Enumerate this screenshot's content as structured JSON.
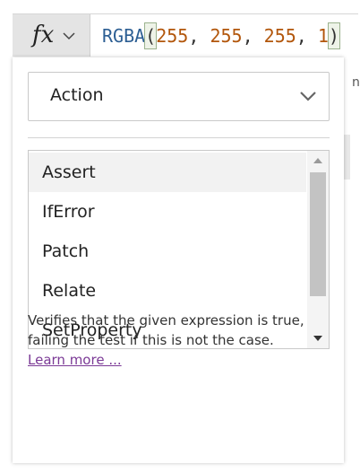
{
  "formula_bar": {
    "fx_label": "fx",
    "function_name": "RGBA",
    "open_paren": "(",
    "arg1": "255",
    "sep1": ", ",
    "arg2": "255",
    "sep2": ", ",
    "arg3": "255",
    "sep3": ", ",
    "arg4": "1",
    "close_paren": ")"
  },
  "category_select": {
    "selected": "Action"
  },
  "functions_list": {
    "items": [
      "Assert",
      "IfError",
      "Patch",
      "Relate",
      "SetProperty"
    ],
    "selected_index": 0
  },
  "description": {
    "text": "Verifies that the given expression is true, failing the test if this is not the case.",
    "link_label": "Learn more ..."
  },
  "background": {
    "partial_glyph": "n"
  },
  "colors": {
    "function": "#2c5e93",
    "number": "#b2560b",
    "link": "#7b3a96",
    "scroll_thumb": "#c3c3c3"
  },
  "icons": {
    "fx_dropdown": "chevron-down-icon",
    "select_dropdown": "chevron-down-icon",
    "scroll_up": "triangle-up-icon",
    "scroll_down": "triangle-down-icon"
  }
}
